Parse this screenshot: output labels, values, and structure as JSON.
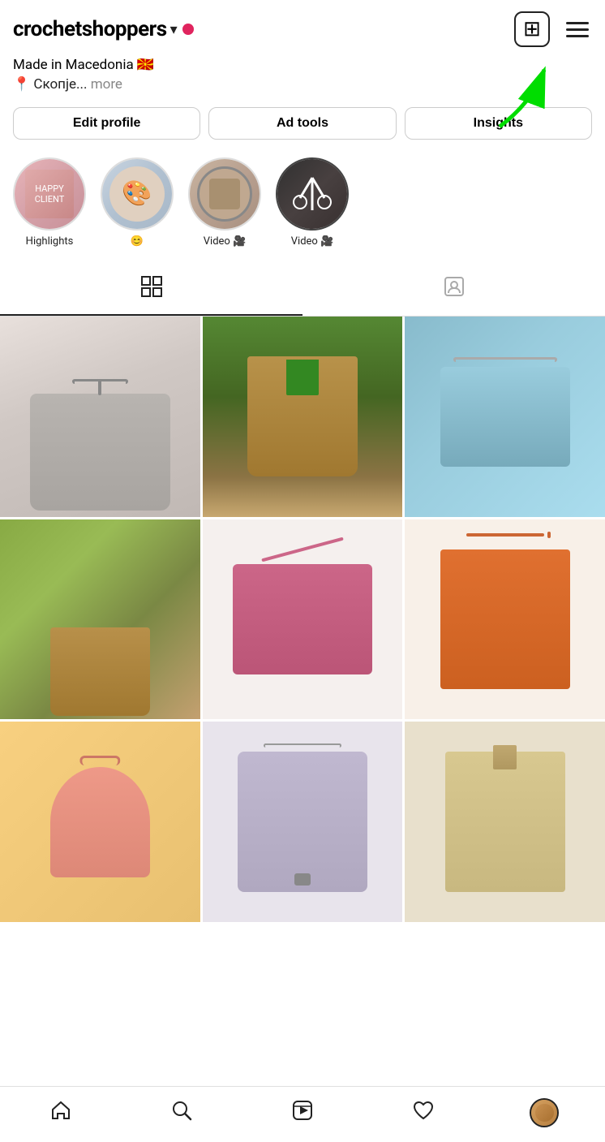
{
  "header": {
    "username": "crochetshoppers",
    "chevron": "▾",
    "live_dot_color": "#e0245e",
    "add_label": "+",
    "menu_label": "☰"
  },
  "bio": {
    "line1": "Made in Macedonia 🇲🇰",
    "line2": "📍 Скопје...",
    "more_label": "more"
  },
  "actions": {
    "edit_profile": "Edit profile",
    "ad_tools": "Ad tools",
    "insights": "Insights"
  },
  "highlights": [
    {
      "label": "Highlights",
      "emoji": ""
    },
    {
      "label": "😊",
      "emoji": "😊"
    },
    {
      "label": "Video 🎥",
      "emoji": ""
    },
    {
      "label": "Video 🎥",
      "emoji": ""
    }
  ],
  "tabs": [
    {
      "name": "grid",
      "label": "⊞",
      "active": true
    },
    {
      "name": "tagged",
      "label": "👤",
      "active": false
    }
  ],
  "grid": {
    "items": [
      {
        "id": 1,
        "class": "img-1"
      },
      {
        "id": 2,
        "class": "img-2"
      },
      {
        "id": 3,
        "class": "img-3"
      },
      {
        "id": 4,
        "class": "img-4"
      },
      {
        "id": 5,
        "class": "img-5"
      },
      {
        "id": 6,
        "class": "img-6"
      },
      {
        "id": 7,
        "class": "img-7"
      },
      {
        "id": 8,
        "class": "img-8"
      },
      {
        "id": 9,
        "class": "img-9"
      }
    ]
  },
  "bottom_nav": {
    "home": "🏠",
    "search": "🔍",
    "reels": "▶",
    "heart": "♡"
  },
  "arrow": {
    "color": "#00dd00"
  }
}
